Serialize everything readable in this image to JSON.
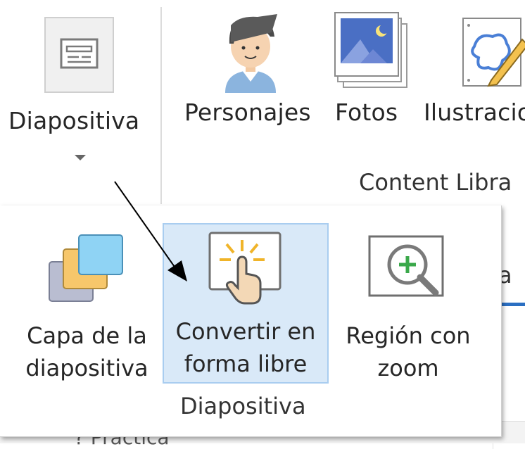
{
  "ribbon": {
    "slide_button": {
      "label": "Diapositiva",
      "icon": "slide-layout-icon"
    },
    "characters_button": {
      "label": "Personajes",
      "icon": "person-icon"
    },
    "photos_button": {
      "label": "Fotos",
      "icon": "photo-icon"
    },
    "illustrations_button": {
      "label": "Ilustracio",
      "icon": "illustration-icon"
    },
    "content_library_group_label": "Content Libra"
  },
  "background": {
    "partial_text": "a",
    "bottom_partial_text": "? Practica"
  },
  "dropdown": {
    "group_label": "Diapositiva",
    "items": [
      {
        "line1": "Capa de la",
        "line2": "diapositiva",
        "icon": "slide-layers-icon"
      },
      {
        "line1": "Convertir en",
        "line2": "forma libre",
        "icon": "click-hand-icon",
        "selected": true
      },
      {
        "line1": "Región con",
        "line2": "zoom",
        "icon": "zoom-region-icon"
      }
    ]
  },
  "colors": {
    "selected_bg": "#d9e9f8",
    "selected_border": "#a9cdf0",
    "layer_blue": "#8fd3f4",
    "layer_yellow": "#f7c76b",
    "layer_gray": "#b9bdd1",
    "zoom_green": "#3aa84a"
  }
}
